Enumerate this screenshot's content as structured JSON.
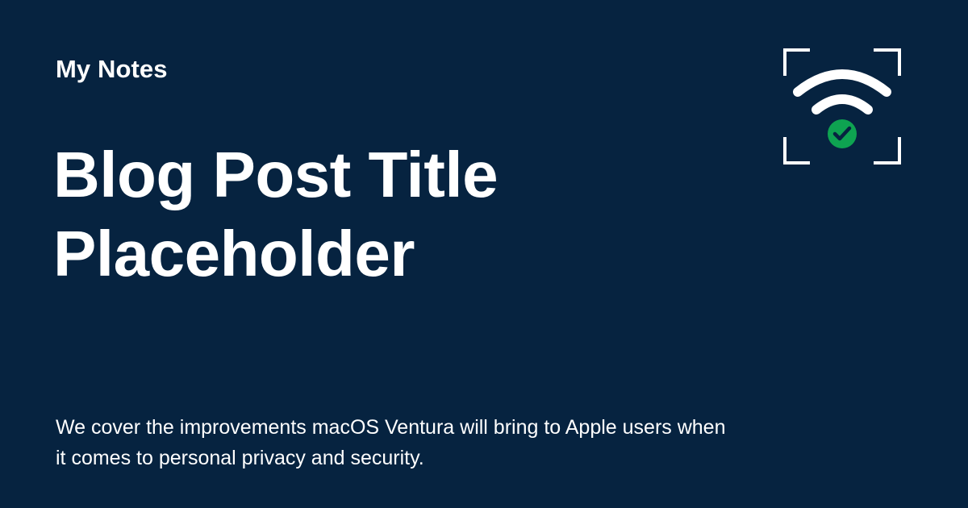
{
  "header": {
    "site_name": "My Notes"
  },
  "post": {
    "title": "Blog Post Title Placeholder",
    "description": "We cover the improvements macOS Ventura will bring to Apple users when it comes to personal privacy and security."
  },
  "logo": {
    "icon": "wifi-check-icon"
  },
  "colors": {
    "background": "#062340",
    "text": "#ffffff",
    "accent_green": "#0ea351"
  }
}
